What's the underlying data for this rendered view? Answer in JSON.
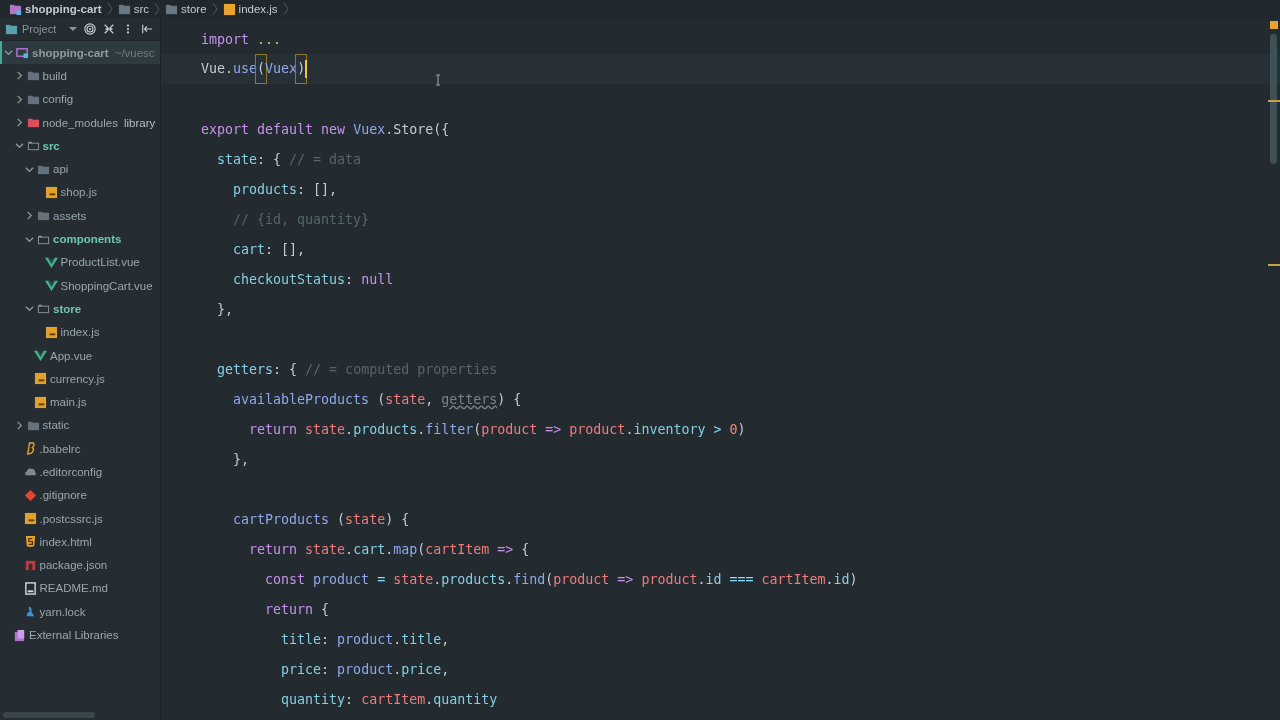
{
  "breadcrumb": [
    {
      "label": "shopping-cart",
      "kind": "project"
    },
    {
      "label": "src",
      "kind": "folder"
    },
    {
      "label": "store",
      "kind": "folder"
    },
    {
      "label": "index.js",
      "kind": "js"
    }
  ],
  "project_panel": {
    "title": "Project"
  },
  "tree": [
    {
      "label": "shopping-cart",
      "note": "~/vuesc",
      "kind": "project",
      "expanded": true,
      "selected": true,
      "children": [
        {
          "label": "build",
          "kind": "folder",
          "expanded": false,
          "selected": false
        },
        {
          "label": "config",
          "kind": "folder",
          "expanded": false,
          "selected": false
        },
        {
          "label": "node_modules",
          "note": "library",
          "kind": "folder-excluded",
          "expanded": false,
          "selected": false
        },
        {
          "label": "src",
          "kind": "folder-outline",
          "color": "#6ec6b2",
          "expanded": true,
          "selected": false,
          "children": [
            {
              "label": "api",
              "kind": "folder",
              "expanded": true,
              "selected": false,
              "children": [
                {
                  "label": "shop.js",
                  "kind": "js",
                  "selected": false
                }
              ]
            },
            {
              "label": "assets",
              "kind": "folder",
              "expanded": false,
              "selected": false
            },
            {
              "label": "components",
              "kind": "folder-outline",
              "color": "#6ec6b2",
              "expanded": true,
              "selected": false,
              "children": [
                {
                  "label": "ProductList.vue",
                  "kind": "vue",
                  "selected": false
                },
                {
                  "label": "ShoppingCart.vue",
                  "kind": "vue",
                  "selected": false
                }
              ]
            },
            {
              "label": "store",
              "kind": "folder-outline",
              "color": "#6ec6b2",
              "expanded": true,
              "selected": false,
              "children": [
                {
                  "label": "index.js",
                  "kind": "js",
                  "selected": false
                }
              ]
            },
            {
              "label": "App.vue",
              "kind": "vue",
              "selected": false
            },
            {
              "label": "currency.js",
              "kind": "js",
              "selected": false
            },
            {
              "label": "main.js",
              "kind": "js",
              "selected": false
            }
          ]
        },
        {
          "label": "static",
          "kind": "folder",
          "expanded": false,
          "selected": false
        },
        {
          "label": ".babelrc",
          "kind": "babel",
          "selected": false
        },
        {
          "label": ".editorconfig",
          "kind": "cloud",
          "selected": false
        },
        {
          "label": ".gitignore",
          "kind": "git",
          "selected": false
        },
        {
          "label": ".postcssrc.js",
          "kind": "js",
          "selected": false
        },
        {
          "label": "index.html",
          "kind": "html",
          "selected": false
        },
        {
          "label": "package.json",
          "kind": "npm",
          "selected": false
        },
        {
          "label": "README.md",
          "kind": "readme",
          "selected": false
        },
        {
          "label": "yarn.lock",
          "kind": "yarn",
          "selected": false
        }
      ]
    },
    {
      "label": "External Libraries",
      "kind": "library",
      "selected": false
    }
  ],
  "code": [
    {
      "kind": "code",
      "tokens": [
        {
          "t": "import ",
          "kind": "kw"
        },
        {
          "t": "...",
          "kind": "fold"
        }
      ]
    },
    {
      "kind": "code",
      "current": true,
      "tokens": [
        {
          "t": "Vue"
        },
        {
          "t": ".",
          "kind": "fold"
        },
        {
          "t": "use",
          "kind": "fn"
        },
        {
          "t": "(",
          "kind": "match"
        },
        {
          "t": "Vuex",
          "kind": "cls"
        },
        {
          "t": ")",
          "kind": "match"
        }
      ]
    },
    {
      "kind": "blank"
    },
    {
      "kind": "code",
      "tokens": [
        {
          "t": "export ",
          "kind": "kw"
        },
        {
          "t": "default ",
          "kind": "kw"
        },
        {
          "t": "new ",
          "kind": "kw"
        },
        {
          "t": "Vuex",
          "kind": "cls"
        },
        {
          "t": ".",
          "kind": "fold"
        },
        {
          "t": "Store({"
        }
      ]
    },
    {
      "kind": "code",
      "tokens": [
        {
          "t": "  state",
          "kind": "prop"
        },
        {
          "t": ": { "
        },
        {
          "t": "// = data",
          "kind": "cm"
        }
      ]
    },
    {
      "kind": "code",
      "tokens": [
        {
          "t": "    products",
          "kind": "prop"
        },
        {
          "t": ": [],"
        }
      ]
    },
    {
      "kind": "code",
      "tokens": [
        {
          "t": "    // {id, quantity}",
          "kind": "cm"
        }
      ]
    },
    {
      "kind": "code",
      "tokens": [
        {
          "t": "    cart",
          "kind": "prop"
        },
        {
          "t": ": [],"
        }
      ]
    },
    {
      "kind": "code",
      "tokens": [
        {
          "t": "    checkoutStatus",
          "kind": "prop"
        },
        {
          "t": ": "
        },
        {
          "t": "null",
          "kind": "kw"
        }
      ]
    },
    {
      "kind": "code",
      "tokens": [
        {
          "t": "  },"
        }
      ]
    },
    {
      "kind": "blank"
    },
    {
      "kind": "code",
      "tokens": [
        {
          "t": "  getters",
          "kind": "prop"
        },
        {
          "t": ": { "
        },
        {
          "t": "// = computed properties",
          "kind": "cm"
        }
      ]
    },
    {
      "kind": "code",
      "tokens": [
        {
          "t": "    availableProducts",
          "kind": "fn"
        },
        {
          "t": " ("
        },
        {
          "t": "state",
          "kind": "param"
        },
        {
          "t": ", "
        },
        {
          "t": "getters",
          "kind": "unused"
        },
        {
          "t": ") {"
        }
      ]
    },
    {
      "kind": "code",
      "tokens": [
        {
          "t": "      return ",
          "kind": "kw"
        },
        {
          "t": "state",
          "kind": "param"
        },
        {
          "t": "."
        },
        {
          "t": "products",
          "kind": "prop"
        },
        {
          "t": "."
        },
        {
          "t": "filter",
          "kind": "fn"
        },
        {
          "t": "("
        },
        {
          "t": "product ",
          "kind": "param"
        },
        {
          "t": "=> ",
          "kind": "kw"
        },
        {
          "t": "product",
          "kind": "param"
        },
        {
          "t": "."
        },
        {
          "t": "inventory ",
          "kind": "prop"
        },
        {
          "t": "> ",
          "kind": "op"
        },
        {
          "t": "0",
          "kind": "num"
        },
        {
          "t": ")"
        }
      ]
    },
    {
      "kind": "code",
      "tokens": [
        {
          "t": "    },"
        }
      ]
    },
    {
      "kind": "blank"
    },
    {
      "kind": "code",
      "tokens": [
        {
          "t": "    cartProducts",
          "kind": "fn"
        },
        {
          "t": " ("
        },
        {
          "t": "state",
          "kind": "param"
        },
        {
          "t": ") {"
        }
      ]
    },
    {
      "kind": "code",
      "tokens": [
        {
          "t": "      return ",
          "kind": "kw"
        },
        {
          "t": "state",
          "kind": "param"
        },
        {
          "t": "."
        },
        {
          "t": "cart",
          "kind": "prop"
        },
        {
          "t": "."
        },
        {
          "t": "map",
          "kind": "fn"
        },
        {
          "t": "("
        },
        {
          "t": "cartItem ",
          "kind": "param"
        },
        {
          "t": "=>",
          "kind": "kw"
        },
        {
          "t": " {"
        }
      ]
    },
    {
      "kind": "code",
      "tokens": [
        {
          "t": "        const ",
          "kind": "kw"
        },
        {
          "t": "product ",
          "kind": "var"
        },
        {
          "t": "= ",
          "kind": "op"
        },
        {
          "t": "state",
          "kind": "param"
        },
        {
          "t": "."
        },
        {
          "t": "products",
          "kind": "prop"
        },
        {
          "t": "."
        },
        {
          "t": "find",
          "kind": "fn"
        },
        {
          "t": "("
        },
        {
          "t": "product ",
          "kind": "param"
        },
        {
          "t": "=> ",
          "kind": "kw"
        },
        {
          "t": "product",
          "kind": "param"
        },
        {
          "t": "."
        },
        {
          "t": "id ",
          "kind": "prop"
        },
        {
          "t": "=== ",
          "kind": "op"
        },
        {
          "t": "cartItem",
          "kind": "param"
        },
        {
          "t": "."
        },
        {
          "t": "id",
          "kind": "prop"
        },
        {
          "t": ")"
        }
      ]
    },
    {
      "kind": "code",
      "tokens": [
        {
          "t": "        return",
          "kind": "kw"
        },
        {
          "t": " {"
        }
      ]
    },
    {
      "kind": "code",
      "tokens": [
        {
          "t": "          title",
          "kind": "prop"
        },
        {
          "t": ": "
        },
        {
          "t": "product",
          "kind": "var"
        },
        {
          "t": "."
        },
        {
          "t": "title",
          "kind": "prop"
        },
        {
          "t": ","
        }
      ]
    },
    {
      "kind": "code",
      "tokens": [
        {
          "t": "          price",
          "kind": "prop"
        },
        {
          "t": ": "
        },
        {
          "t": "product",
          "kind": "var"
        },
        {
          "t": "."
        },
        {
          "t": "price",
          "kind": "prop"
        },
        {
          "t": ","
        }
      ]
    },
    {
      "kind": "code",
      "tokens": [
        {
          "t": "          quantity",
          "kind": "prop"
        },
        {
          "t": ": "
        },
        {
          "t": "cartItem",
          "kind": "param"
        },
        {
          "t": "."
        },
        {
          "t": "quantity",
          "kind": "prop"
        }
      ]
    }
  ]
}
